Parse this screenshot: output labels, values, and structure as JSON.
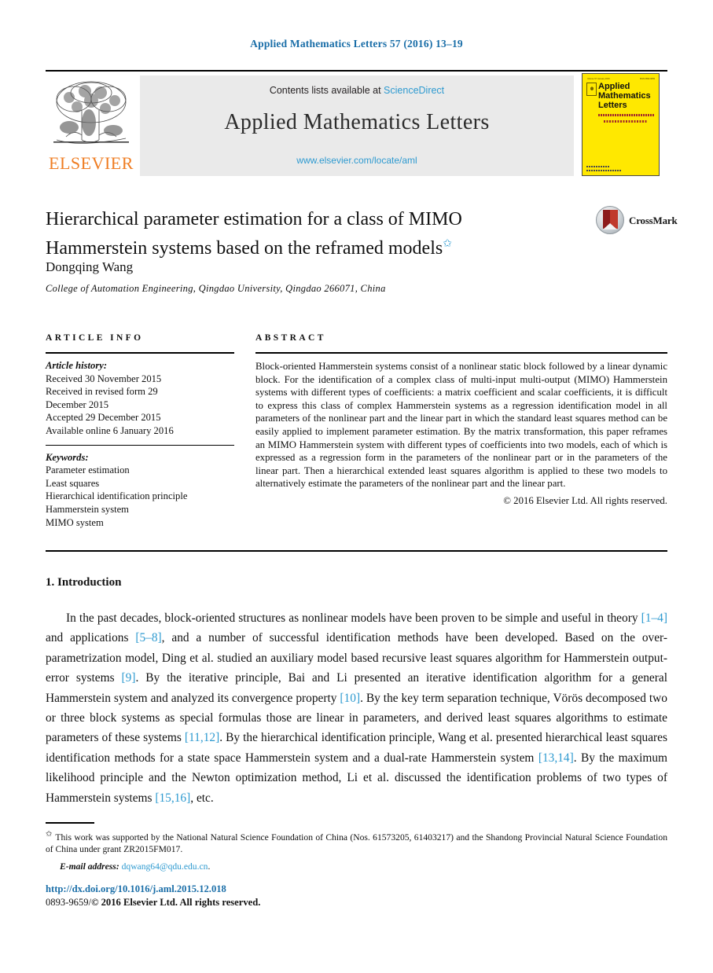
{
  "running_head": "Applied Mathematics Letters 57 (2016) 13–19",
  "masthead": {
    "contents_prefix": "Contents lists available at ",
    "sciencedirect": "ScienceDirect",
    "journal_title": "Applied Mathematics Letters",
    "journal_url": "www.elsevier.com/locate/aml",
    "publisher_wordmark": "ELSEVIER",
    "cover": {
      "volume_line": "Volume 57 January 2016",
      "issn_line": "ISSN 0893-9659",
      "title_line1": "Applied",
      "title_line2": "Mathematics",
      "title_line3": "Letters",
      "subtitle": "AN INTERNATIONAL JOURNAL OF RAPID PUBLICATION",
      "editor": "Editor-in-Chief: Alan Jeffrey"
    }
  },
  "article": {
    "title": "Hierarchical parameter estimation for a class of MIMO Hammerstein systems based on the reframed models",
    "title_footnote_marker": "✩",
    "author": "Dongqing Wang",
    "affiliation": "College of Automation Engineering, Qingdao University, Qingdao 266071, China",
    "crossmark_label": "CrossMark"
  },
  "info": {
    "heading": "ARTICLE INFO",
    "history_label": "Article history:",
    "history": [
      "Received 30 November 2015",
      "Received in revised form 29",
      "December 2015",
      "Accepted 29 December 2015",
      "Available online 6 January 2016"
    ],
    "keywords_label": "Keywords:",
    "keywords": [
      "Parameter estimation",
      "Least squares",
      "Hierarchical identification principle",
      "Hammerstein system",
      "MIMO system"
    ]
  },
  "abstract": {
    "heading": "ABSTRACT",
    "text": "Block-oriented Hammerstein systems consist of a nonlinear static block followed by a linear dynamic block. For the identification of a complex class of multi-input multi-output (MIMO) Hammerstein systems with different types of coefficients: a matrix coefficient and scalar coefficients, it is difficult to express this class of complex Hammerstein systems as a regression identification model in all parameters of the nonlinear part and the linear part in which the standard least squares method can be easily applied to implement parameter estimation. By the matrix transformation, this paper reframes an MIMO Hammerstein system with different types of coefficients into two models, each of which is expressed as a regression form in the parameters of the nonlinear part or in the parameters of the linear part. Then a hierarchical extended least squares algorithm is applied to these two models to alternatively estimate the parameters of the nonlinear part and the linear part.",
    "copyright": "© 2016 Elsevier Ltd. All rights reserved."
  },
  "body": {
    "section_number_title": "1. Introduction",
    "paragraph_segments": [
      {
        "t": "In the past decades, block-oriented structures as nonlinear models have been proven to be simple and useful in theory ",
        "ref": false
      },
      {
        "t": "[1–4]",
        "ref": true
      },
      {
        "t": " and applications ",
        "ref": false
      },
      {
        "t": "[5–8]",
        "ref": true
      },
      {
        "t": ", and a number of successful identification methods have been developed. Based on the over-parametrization model, Ding et al. studied an auxiliary model based recursive least squares algorithm for Hammerstein output-error systems ",
        "ref": false
      },
      {
        "t": "[9]",
        "ref": true
      },
      {
        "t": ". By the iterative principle, Bai and Li presented an iterative identification algorithm for a general Hammerstein system and analyzed its convergence property ",
        "ref": false
      },
      {
        "t": "[10]",
        "ref": true
      },
      {
        "t": ". By the key term separation technique, Vörös decomposed two or three block systems as special formulas those are linear in parameters, and derived least squares algorithms to estimate parameters of these systems ",
        "ref": false
      },
      {
        "t": "[11,12]",
        "ref": true
      },
      {
        "t": ". By the hierarchical identification principle, Wang et al. presented hierarchical least squares identification methods for a state space Hammerstein system and a dual-rate Hammerstein system ",
        "ref": false
      },
      {
        "t": "[13,14]",
        "ref": true
      },
      {
        "t": ". By the maximum likelihood principle and the Newton optimization method, Li et al. discussed the identification problems of two types of Hammerstein systems ",
        "ref": false
      },
      {
        "t": "[15,16]",
        "ref": true
      },
      {
        "t": ", etc.",
        "ref": false
      }
    ]
  },
  "footnotes": {
    "star_marker": "✩",
    "funding": "This work was supported by the National Natural Science Foundation of China (Nos. 61573205, 61403217) and the Shandong Provincial Natural Science Foundation of China under grant ZR2015FM017.",
    "email_label": "E-mail address:",
    "email": "dqwang64@qdu.edu.cn",
    "email_trailing": "."
  },
  "footer": {
    "doi": "http://dx.doi.org/10.1016/j.aml.2015.12.018",
    "issn_prefix": "0893-9659/",
    "issn_copyright": "© 2016 Elsevier Ltd. All rights reserved."
  },
  "colors": {
    "link": "#2e9ad0",
    "running_head": "#1a6ea8",
    "elsevier_orange": "#ef7d23",
    "cover_yellow": "#ffe800",
    "masthead_grey": "#eaeaea"
  }
}
